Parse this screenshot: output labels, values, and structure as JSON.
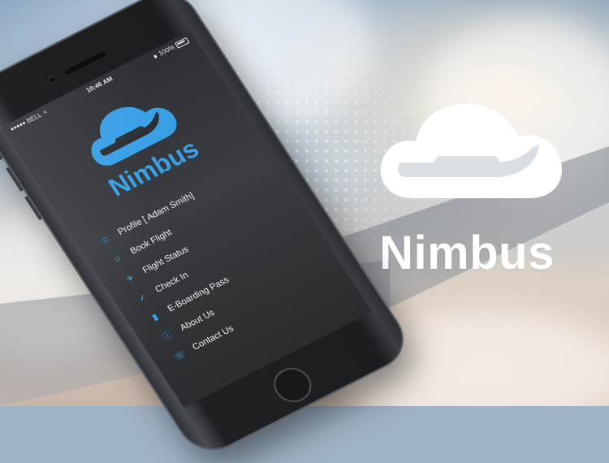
{
  "brand": {
    "name": "Nimbus"
  },
  "status_bar": {
    "carrier": "BELL",
    "time": "10:46 AM",
    "battery": "100%"
  },
  "app": {
    "name": "Nimbus"
  },
  "menu": {
    "items": [
      {
        "label": "Profile [ Adam Smith]",
        "icon": "user-icon"
      },
      {
        "label": "Book Flight",
        "icon": "user-icon"
      },
      {
        "label": "Flight Status",
        "icon": "plane-icon"
      },
      {
        "label": "Check In",
        "icon": "check-icon"
      },
      {
        "label": "E-Boarding Pass",
        "icon": "ticket-icon"
      },
      {
        "label": "About Us",
        "icon": "info-icon"
      },
      {
        "label": "Contact Us",
        "icon": "headset-icon"
      }
    ]
  },
  "colors": {
    "accent": "#3aa0e6",
    "brand_text": "#ffffff",
    "phone_body": "#1b1d20"
  }
}
